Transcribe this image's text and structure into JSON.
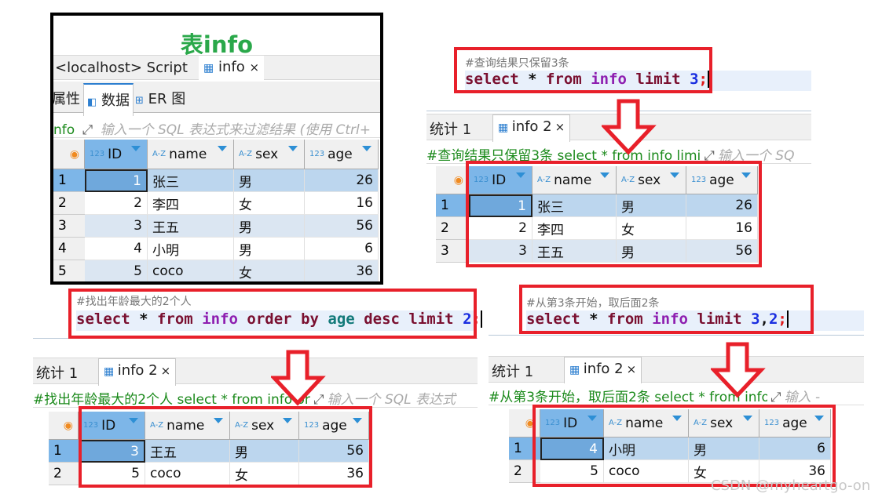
{
  "panel_table": {
    "title": "表info",
    "script_tab": "<localhost> Script",
    "tab_label": "info",
    "close": "×",
    "subtabs": [
      "属性",
      "数据",
      "ER 图"
    ],
    "filter_query": "nfo",
    "filter_placeholder": "输入一个 SQL 表达式来过滤结果 (使用 Ctrl+",
    "columns": [
      {
        "type": "123",
        "name": "ID"
      },
      {
        "type": "A-Z",
        "name": "name"
      },
      {
        "type": "A-Z",
        "name": "sex"
      },
      {
        "type": "123",
        "name": "age"
      }
    ],
    "rows": [
      [
        "1",
        "1",
        "张三",
        "男",
        "26"
      ],
      [
        "2",
        "2",
        "李四",
        "女",
        "16"
      ],
      [
        "3",
        "3",
        "王五",
        "男",
        "56"
      ],
      [
        "4",
        "4",
        "小明",
        "男",
        "6"
      ],
      [
        "5",
        "5",
        "coco",
        "女",
        "36"
      ]
    ]
  },
  "panel_limit3": {
    "comment": "#查询结果只保留3条",
    "sql": [
      {
        "t": "select",
        "k": "kw"
      },
      {
        "t": " * ",
        "k": "op"
      },
      {
        "t": "from",
        "k": "kw"
      },
      {
        "t": " ",
        "k": "op"
      },
      {
        "t": "info",
        "k": "tb"
      },
      {
        "t": " ",
        "k": "op"
      },
      {
        "t": "limit",
        "k": "kw"
      },
      {
        "t": " ",
        "k": "op"
      },
      {
        "t": "3",
        "k": "num"
      },
      {
        "t": ";",
        "k": "semi"
      }
    ],
    "stats_tab": "统计 1",
    "tab_label": "info 2",
    "close": "×",
    "filter_query": "#查询结果只保留3条 select * from info limi",
    "filter_placeholder": "输入一个 SQ",
    "columns": [
      {
        "type": "123",
        "name": "ID"
      },
      {
        "type": "A-Z",
        "name": "name"
      },
      {
        "type": "A-Z",
        "name": "sex"
      },
      {
        "type": "123",
        "name": "age"
      }
    ],
    "rows": [
      [
        "1",
        "1",
        "张三",
        "男",
        "26"
      ],
      [
        "2",
        "2",
        "李四",
        "女",
        "16"
      ],
      [
        "3",
        "3",
        "王五",
        "男",
        "56"
      ]
    ]
  },
  "panel_top2": {
    "comment": "#找出年龄最大的2个人",
    "sql": [
      {
        "t": "select",
        "k": "kw"
      },
      {
        "t": " * ",
        "k": "op"
      },
      {
        "t": "from",
        "k": "kw"
      },
      {
        "t": " ",
        "k": "op"
      },
      {
        "t": "info",
        "k": "tb"
      },
      {
        "t": " ",
        "k": "op"
      },
      {
        "t": "order",
        "k": "kw"
      },
      {
        "t": " ",
        "k": "op"
      },
      {
        "t": "by",
        "k": "kw"
      },
      {
        "t": " ",
        "k": "op"
      },
      {
        "t": "age",
        "k": "col"
      },
      {
        "t": " ",
        "k": "op"
      },
      {
        "t": "desc",
        "k": "kw"
      },
      {
        "t": " ",
        "k": "op"
      },
      {
        "t": "limit",
        "k": "kw"
      },
      {
        "t": " ",
        "k": "op"
      },
      {
        "t": "2",
        "k": "num"
      },
      {
        "t": ";",
        "k": "semi"
      }
    ],
    "stats_tab": "统计 1",
    "tab_label": "info 2",
    "close": "×",
    "filter_query": "#找出年龄最大的2个人 select * from info or",
    "filter_placeholder": "输入一个 SQL 表达式",
    "columns": [
      {
        "type": "123",
        "name": "ID"
      },
      {
        "type": "A-Z",
        "name": "name"
      },
      {
        "type": "A-Z",
        "name": "sex"
      },
      {
        "type": "123",
        "name": "age"
      }
    ],
    "rows": [
      [
        "1",
        "3",
        "王五",
        "男",
        "56"
      ],
      [
        "2",
        "5",
        "coco",
        "女",
        "36"
      ]
    ]
  },
  "panel_offset": {
    "comment": "#从第3条开始，取后面2条",
    "sql": [
      {
        "t": "select",
        "k": "kw"
      },
      {
        "t": " * ",
        "k": "op"
      },
      {
        "t": "from",
        "k": "kw"
      },
      {
        "t": " ",
        "k": "op"
      },
      {
        "t": "info",
        "k": "tb"
      },
      {
        "t": " ",
        "k": "op"
      },
      {
        "t": "limit",
        "k": "kw"
      },
      {
        "t": " ",
        "k": "op"
      },
      {
        "t": "3",
        "k": "num"
      },
      {
        "t": ",",
        "k": "op"
      },
      {
        "t": "2",
        "k": "num"
      },
      {
        "t": ";",
        "k": "semi"
      }
    ],
    "stats_tab": "统计 1",
    "tab_label": "info 2",
    "close": "×",
    "filter_query": "#从第3条开始，取后面2条 select * from info",
    "filter_placeholder": "输入 -",
    "columns": [
      {
        "type": "123",
        "name": "ID"
      },
      {
        "type": "A-Z",
        "name": "name"
      },
      {
        "type": "A-Z",
        "name": "sex"
      },
      {
        "type": "123",
        "name": "age"
      }
    ],
    "rows": [
      [
        "1",
        "4",
        "小明",
        "男",
        "6"
      ],
      [
        "2",
        "5",
        "coco",
        "女",
        "36"
      ]
    ]
  },
  "watermark": "CSDN @myheartgo-on",
  "colors": {
    "highlight_red": "#e8202a",
    "title_green": "#2aa84a",
    "selected_header": "#7db6e8",
    "selected_row": "#bcd6ee",
    "alt_row": "#dbe6f2"
  }
}
